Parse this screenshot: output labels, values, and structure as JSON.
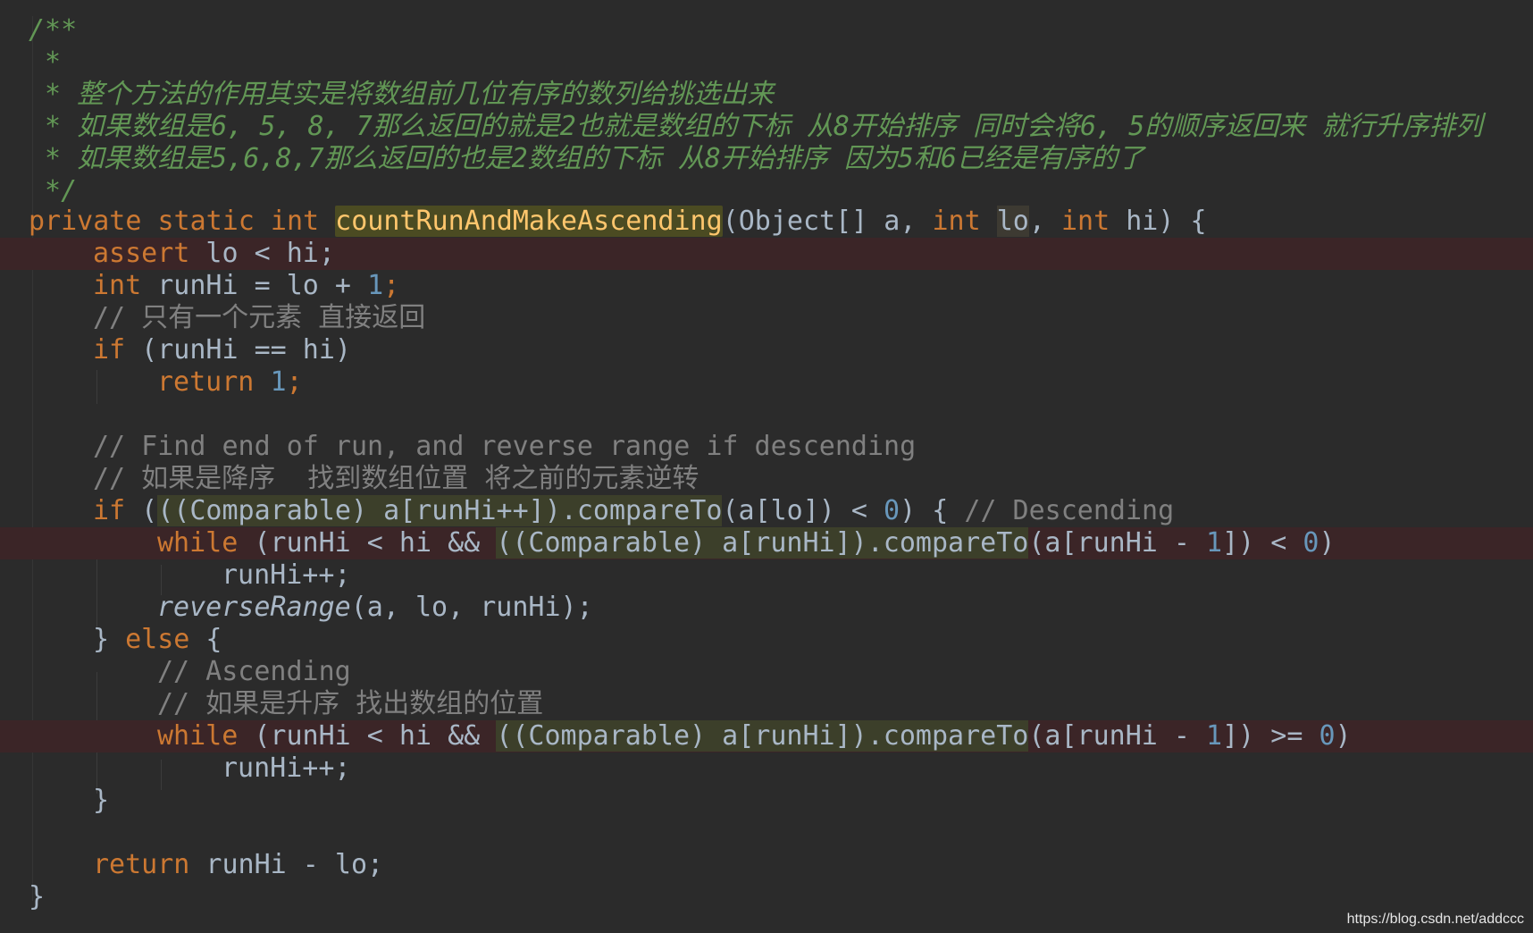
{
  "editor": {
    "theme": "darcula",
    "colors": {
      "background": "#2b2b2b",
      "keyword": "#cc7832",
      "comment": "#808080",
      "doc_comment": "#629755",
      "number": "#6897bb",
      "method": "#ffc66d",
      "breakpoint_line": "#3b2527"
    },
    "lines": {
      "l1": "/**",
      "l2": " *",
      "l3": " * 整个方法的作用其实是将数组前几位有序的数列给挑选出来",
      "l4": " * 如果数组是6, 5, 8, 7那么返回的就是2也就是数组的下标 从8开始排序 同时会将6, 5的顺序返回来 就行升序排列",
      "l5": " * 如果数组是5,6,8,7那么返回的也是2数组的下标 从8开始排序 因为5和6已经是有序的了",
      "l6": " */",
      "l7": {
        "kw": "private static int",
        "method": "countRunAndMakeAscending",
        "p1": "(Object[] a, ",
        "kw2": "int",
        "var": "lo",
        "p2": ", ",
        "kw3": "int",
        "p3": " hi) {"
      },
      "l8": {
        "kw": "assert",
        "rest": " lo < hi;"
      },
      "l9": {
        "kw": "int",
        "rest": " runHi = lo + ",
        "num": "1",
        "end": ";"
      },
      "l10": "// 只有一个元素 直接返回",
      "l11": {
        "kw": "if",
        "rest": " (runHi == hi)"
      },
      "l12": {
        "kw": "return",
        "num": "1",
        "end": ";"
      },
      "l13": "// Find end of run, and reverse range if descending",
      "l14": "// 如果是降序  找到数组位置 将之前的元素逆转",
      "l15": {
        "kw": "if",
        "p1": " (",
        "hl": "((Comparable) a[runHi++]).compareTo",
        "p2": "(a[lo]) < ",
        "num": "0",
        "p3": ") { ",
        "cm": "// Descending"
      },
      "l16": {
        "kw": "while",
        "p1": " (runHi < hi && ",
        "hl": "((Comparable) a[runHi]).compareTo",
        "p2": "(a[runHi - ",
        "num": "1",
        "p3": "]) < ",
        "num2": "0",
        "p4": ")"
      },
      "l17": "runHi++;",
      "l18": {
        "it": "reverseRange",
        "rest": "(a, lo, runHi);"
      },
      "l19": {
        "p1": "} ",
        "kw": "else",
        "p2": " {"
      },
      "l20": "// Ascending",
      "l21": "// 如果是升序 找出数组的位置",
      "l22": {
        "kw": "while",
        "p1": " (runHi < hi && ",
        "hl": "((Comparable) a[runHi]).compareTo",
        "p2": "(a[runHi - ",
        "num": "1",
        "p3": "]) >= ",
        "num2": "0",
        "p4": ")"
      },
      "l23": "runHi++;",
      "l24": "}",
      "l25": {
        "kw": "return",
        "rest": " runHi - lo;"
      },
      "l26": "}"
    }
  },
  "watermark": "https://blog.csdn.net/addccc"
}
